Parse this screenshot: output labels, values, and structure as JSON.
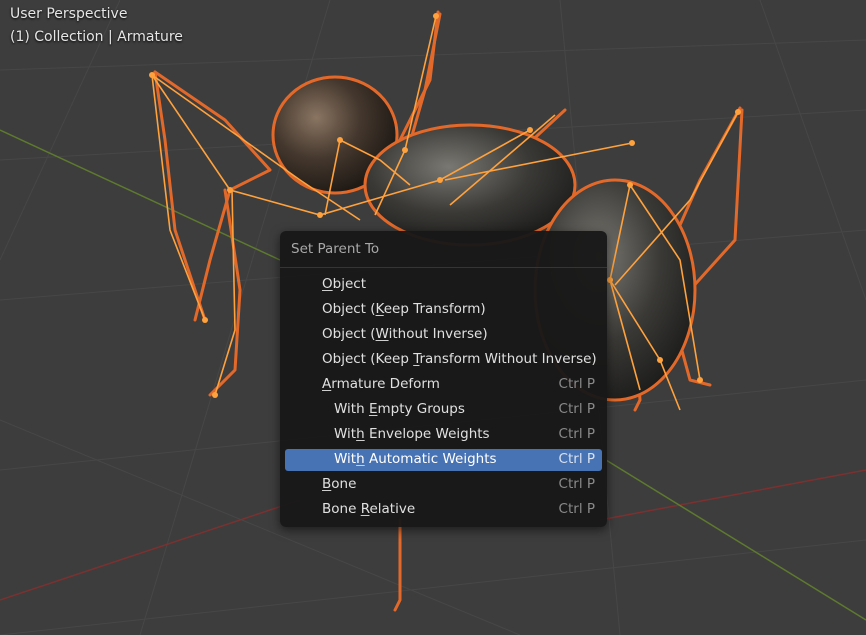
{
  "viewport": {
    "mode_label": "User Perspective",
    "collection_label": "(1) Collection | Armature"
  },
  "context_menu": {
    "title": "Set Parent To",
    "highlight_color": "#4772b3",
    "items": [
      {
        "pre": "",
        "u": "O",
        "post": "bject",
        "shortcut": "",
        "indent": false,
        "active": false
      },
      {
        "pre": "Object (",
        "u": "K",
        "post": "eep Transform)",
        "shortcut": "",
        "indent": false,
        "active": false
      },
      {
        "pre": "Object (",
        "u": "W",
        "post": "ithout Inverse)",
        "shortcut": "",
        "indent": false,
        "active": false
      },
      {
        "pre": "Object (Keep ",
        "u": "T",
        "post": "ransform Without Inverse)",
        "shortcut": "",
        "indent": false,
        "active": false
      },
      {
        "pre": "",
        "u": "A",
        "post": "rmature Deform",
        "shortcut": "Ctrl P",
        "indent": false,
        "active": false
      },
      {
        "pre": "With ",
        "u": "E",
        "post": "mpty Groups",
        "shortcut": "Ctrl P",
        "indent": true,
        "active": false
      },
      {
        "pre": "Wit",
        "u": "h",
        "post": " Envelope Weights",
        "shortcut": "Ctrl P",
        "indent": true,
        "active": false
      },
      {
        "pre": "Wit",
        "u": "h",
        "post": " Automatic Weights",
        "shortcut": "Ctrl P",
        "indent": true,
        "active": true
      },
      {
        "pre": "",
        "u": "B",
        "post": "one",
        "shortcut": "Ctrl P",
        "indent": false,
        "active": false
      },
      {
        "pre": "Bone ",
        "u": "R",
        "post": "elative",
        "shortcut": "Ctrl P",
        "indent": false,
        "active": false
      }
    ]
  }
}
